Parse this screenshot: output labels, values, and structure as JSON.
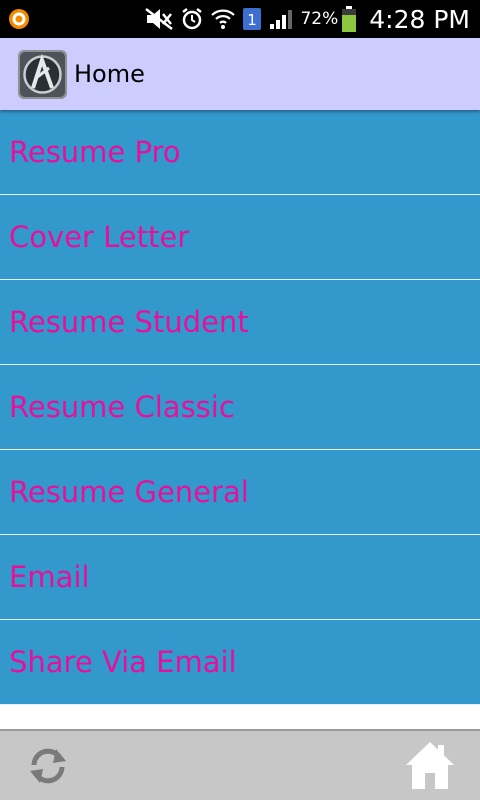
{
  "status_bar": {
    "battery_percent": "72%",
    "time": "4:28 PM",
    "sim_badge": "1",
    "icons": [
      "notification-app-icon",
      "mute-icon",
      "alarm-icon",
      "wifi-icon",
      "sim-badge-icon",
      "signal-icon",
      "battery-icon"
    ]
  },
  "action_bar": {
    "title": "Home",
    "icon": "app-logo-icon"
  },
  "menu": {
    "items": [
      {
        "label": "Resume Pro"
      },
      {
        "label": "Cover Letter"
      },
      {
        "label": "Resume Student"
      },
      {
        "label": "Resume Classic"
      },
      {
        "label": "Resume General"
      },
      {
        "label": "Email"
      },
      {
        "label": "Share Via Email"
      }
    ]
  },
  "bottom_bar": {
    "left_icon": "refresh-icon",
    "right_icon": "home-icon"
  },
  "colors": {
    "status_bg": "#000000",
    "action_bar_bg": "#ccccff",
    "menu_item_bg": "#3399cc",
    "menu_text": "#e6109b",
    "bottom_bar_bg": "#c7c7c7"
  }
}
